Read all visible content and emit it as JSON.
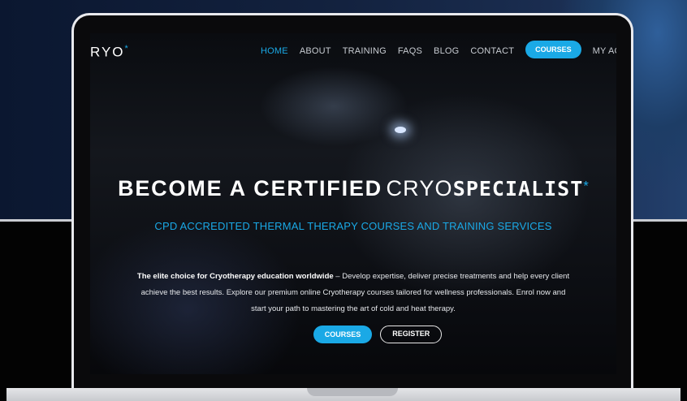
{
  "site": {
    "logo_text": "RYO",
    "logo_mark": "*"
  },
  "nav": {
    "items": [
      {
        "label": "HOME",
        "active": true
      },
      {
        "label": "ABOUT",
        "active": false
      },
      {
        "label": "TRAINING",
        "active": false
      },
      {
        "label": "FAQS",
        "active": false
      },
      {
        "label": "BLOG",
        "active": false
      },
      {
        "label": "CONTACT",
        "active": false
      }
    ],
    "courses_button": "COURSES",
    "account_link": "MY ACCO"
  },
  "hero": {
    "title_part1": "BECOME A CERTIFIED",
    "title_part2": "CRYO",
    "title_part3": "SPECIALIST",
    "title_mark": "*",
    "subtitle": "CPD ACCREDITED THERMAL THERAPY COURSES AND TRAINING SERVICES",
    "desc_bold": "The elite choice for Cryotherapy education worldwide",
    "desc_line1": " – Develop expertise, deliver precise treatments and help every client",
    "desc_line2": "achieve the best results. Explore our premium online Cryotherapy courses tailored for wellness professionals. Enrol now and",
    "desc_line3": "start your path to mastering the art of cold and heat therapy.",
    "cta_primary": "COURSES",
    "cta_secondary": "REGISTER"
  },
  "colors": {
    "accent": "#1aa9e6",
    "frame": "#e9eaee"
  }
}
